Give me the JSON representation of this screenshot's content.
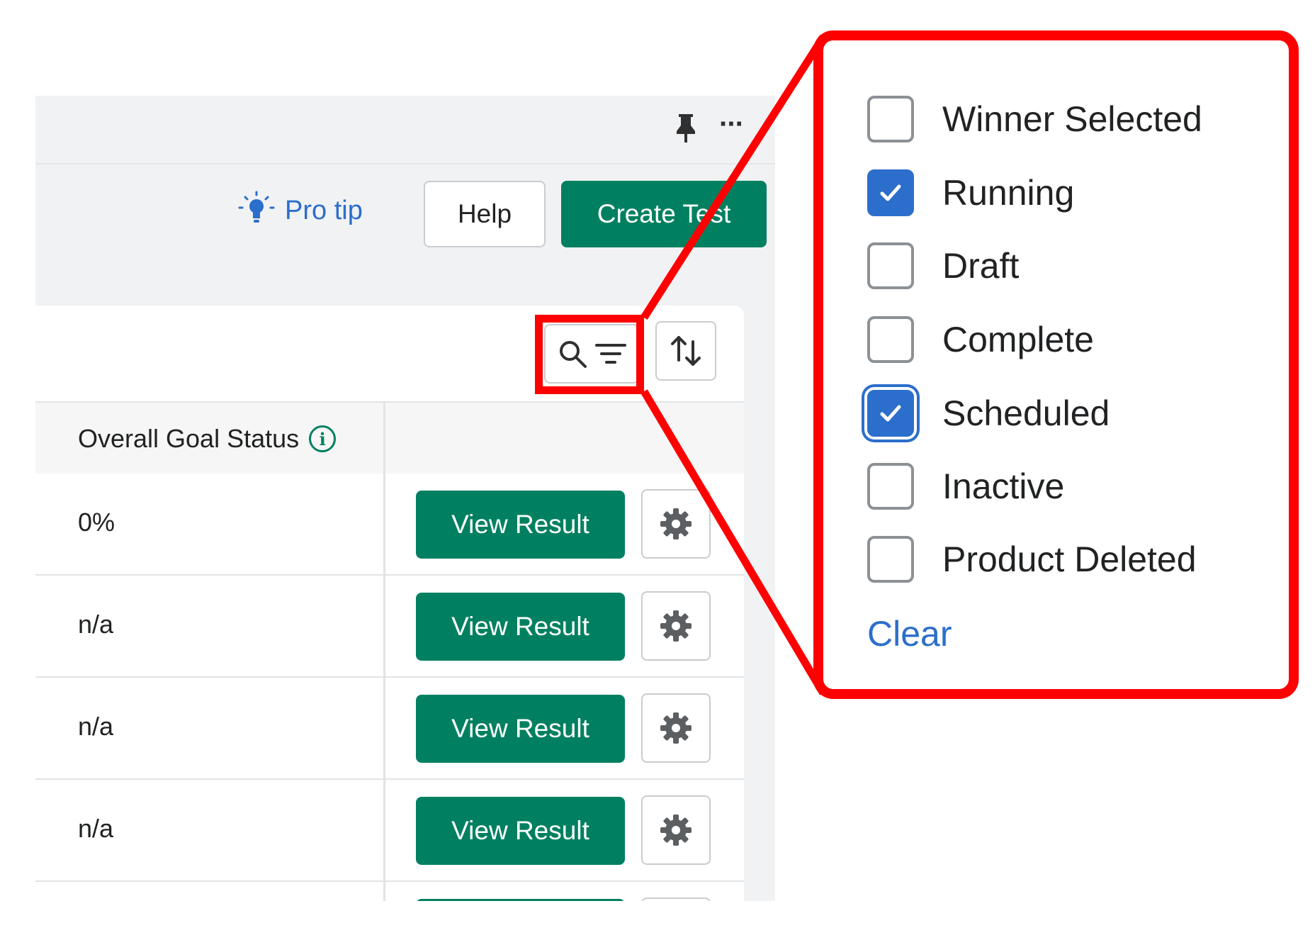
{
  "topbar": {
    "pin_icon": "pin-icon",
    "more_label": "···"
  },
  "header": {
    "protip_label": "Pro tip",
    "help_label": "Help",
    "create_label": "Create Test"
  },
  "toolbar": {
    "search_filter_icons": [
      "search-icon",
      "filter-icon"
    ],
    "sort_icon": "sort-icon"
  },
  "table": {
    "column_header": "Overall Goal Status",
    "rows": [
      {
        "status": "0%",
        "action_label": "View Result"
      },
      {
        "status": "n/a",
        "action_label": "View Result"
      },
      {
        "status": "n/a",
        "action_label": "View Result"
      },
      {
        "status": "n/a",
        "action_label": "View Result"
      }
    ]
  },
  "filter_popover": {
    "options": [
      {
        "label": "Winner Selected",
        "checked": false
      },
      {
        "label": "Running",
        "checked": true
      },
      {
        "label": "Draft",
        "checked": false
      },
      {
        "label": "Complete",
        "checked": false
      },
      {
        "label": "Scheduled",
        "checked": true,
        "focused": true
      },
      {
        "label": "Inactive",
        "checked": false
      },
      {
        "label": "Product Deleted",
        "checked": false
      }
    ],
    "clear_label": "Clear"
  },
  "colors": {
    "primary_green": "#008060",
    "link_blue": "#2c6ecb",
    "callout_red": "#ff0000"
  }
}
